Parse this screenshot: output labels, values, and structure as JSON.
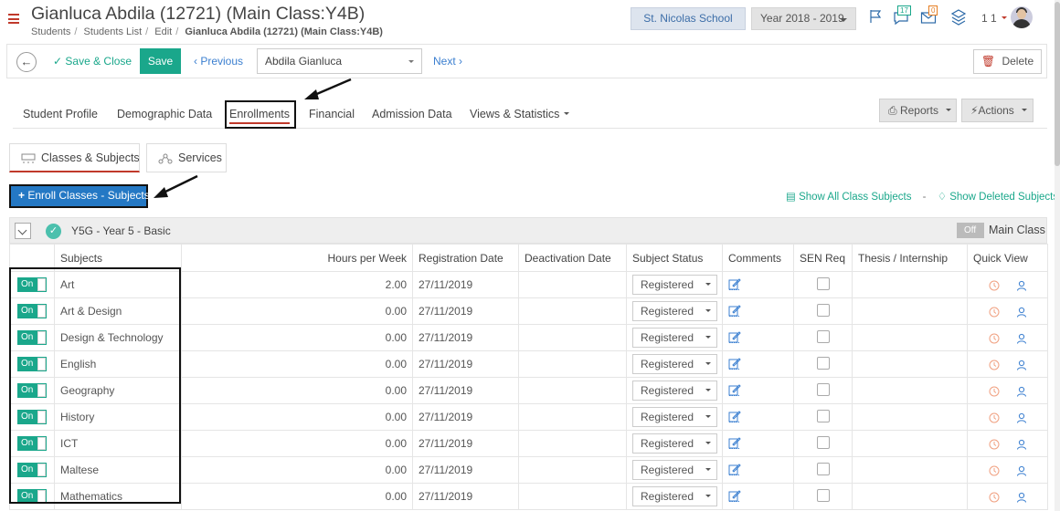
{
  "header": {
    "title": "Gianluca Abdila (12721) (Main Class:Y4B)",
    "breadcrumbs": [
      "Students",
      "Students List",
      "Edit",
      "Gianluca Abdila (12721) (Main Class:Y4B)"
    ],
    "school": "St. Nicolas School",
    "year": "Year 2018 - 2019",
    "notifications_count": "17",
    "messages_count": "0",
    "user_number": "1 1"
  },
  "toolbar": {
    "save_close_label": "Save & Close",
    "save_label": "Save",
    "previous_label": "Previous",
    "student_select_value": "Abdila Gianluca",
    "next_label": "Next",
    "delete_label": "Delete"
  },
  "main_tabs": [
    {
      "label": "Student Profile"
    },
    {
      "label": "Demographic Data"
    },
    {
      "label": "Enrollments"
    },
    {
      "label": "Financial"
    },
    {
      "label": "Admission Data"
    },
    {
      "label": "Views & Statistics"
    }
  ],
  "reports_label": "Reports",
  "actions_label": "Actions",
  "sub_tabs": [
    {
      "label": "Classes & Subjects"
    },
    {
      "label": "Services"
    }
  ],
  "enroll_button_label": "Enroll Classes - Subjects",
  "links": {
    "show_all": "Show All Class Subjects",
    "separator": "-",
    "show_deleted": "Show Deleted Subjects"
  },
  "class_bar": {
    "name": "Y5G - Year 5 - Basic",
    "toggle": "Off",
    "main_class_label": "Main Class"
  },
  "table": {
    "columns": [
      "Subjects",
      "Hours per Week",
      "Registration Date",
      "Deactivation Date",
      "Subject Status",
      "Comments",
      "SEN Req",
      "Thesis / Internship",
      "Quick View"
    ],
    "toggle_label": "On",
    "rows": [
      {
        "subject": "Art",
        "hours": "2.00",
        "reg_date": "27/11/2019",
        "deact_date": "",
        "status": "Registered"
      },
      {
        "subject": "Art & Design",
        "hours": "0.00",
        "reg_date": "27/11/2019",
        "deact_date": "",
        "status": "Registered"
      },
      {
        "subject": "Design & Technology",
        "hours": "0.00",
        "reg_date": "27/11/2019",
        "deact_date": "",
        "status": "Registered"
      },
      {
        "subject": "English",
        "hours": "0.00",
        "reg_date": "27/11/2019",
        "deact_date": "",
        "status": "Registered"
      },
      {
        "subject": "Geography",
        "hours": "0.00",
        "reg_date": "27/11/2019",
        "deact_date": "",
        "status": "Registered"
      },
      {
        "subject": "History",
        "hours": "0.00",
        "reg_date": "27/11/2019",
        "deact_date": "",
        "status": "Registered"
      },
      {
        "subject": "ICT",
        "hours": "0.00",
        "reg_date": "27/11/2019",
        "deact_date": "",
        "status": "Registered"
      },
      {
        "subject": "Maltese",
        "hours": "0.00",
        "reg_date": "27/11/2019",
        "deact_date": "",
        "status": "Registered"
      },
      {
        "subject": "Mathematics",
        "hours": "0.00",
        "reg_date": "27/11/2019",
        "deact_date": "",
        "status": "Registered"
      }
    ]
  },
  "colors": {
    "accent_green": "#1aa78b",
    "link_blue": "#3b7fd0",
    "enroll_blue": "#2478c4",
    "brand_red": "#c0392b"
  }
}
